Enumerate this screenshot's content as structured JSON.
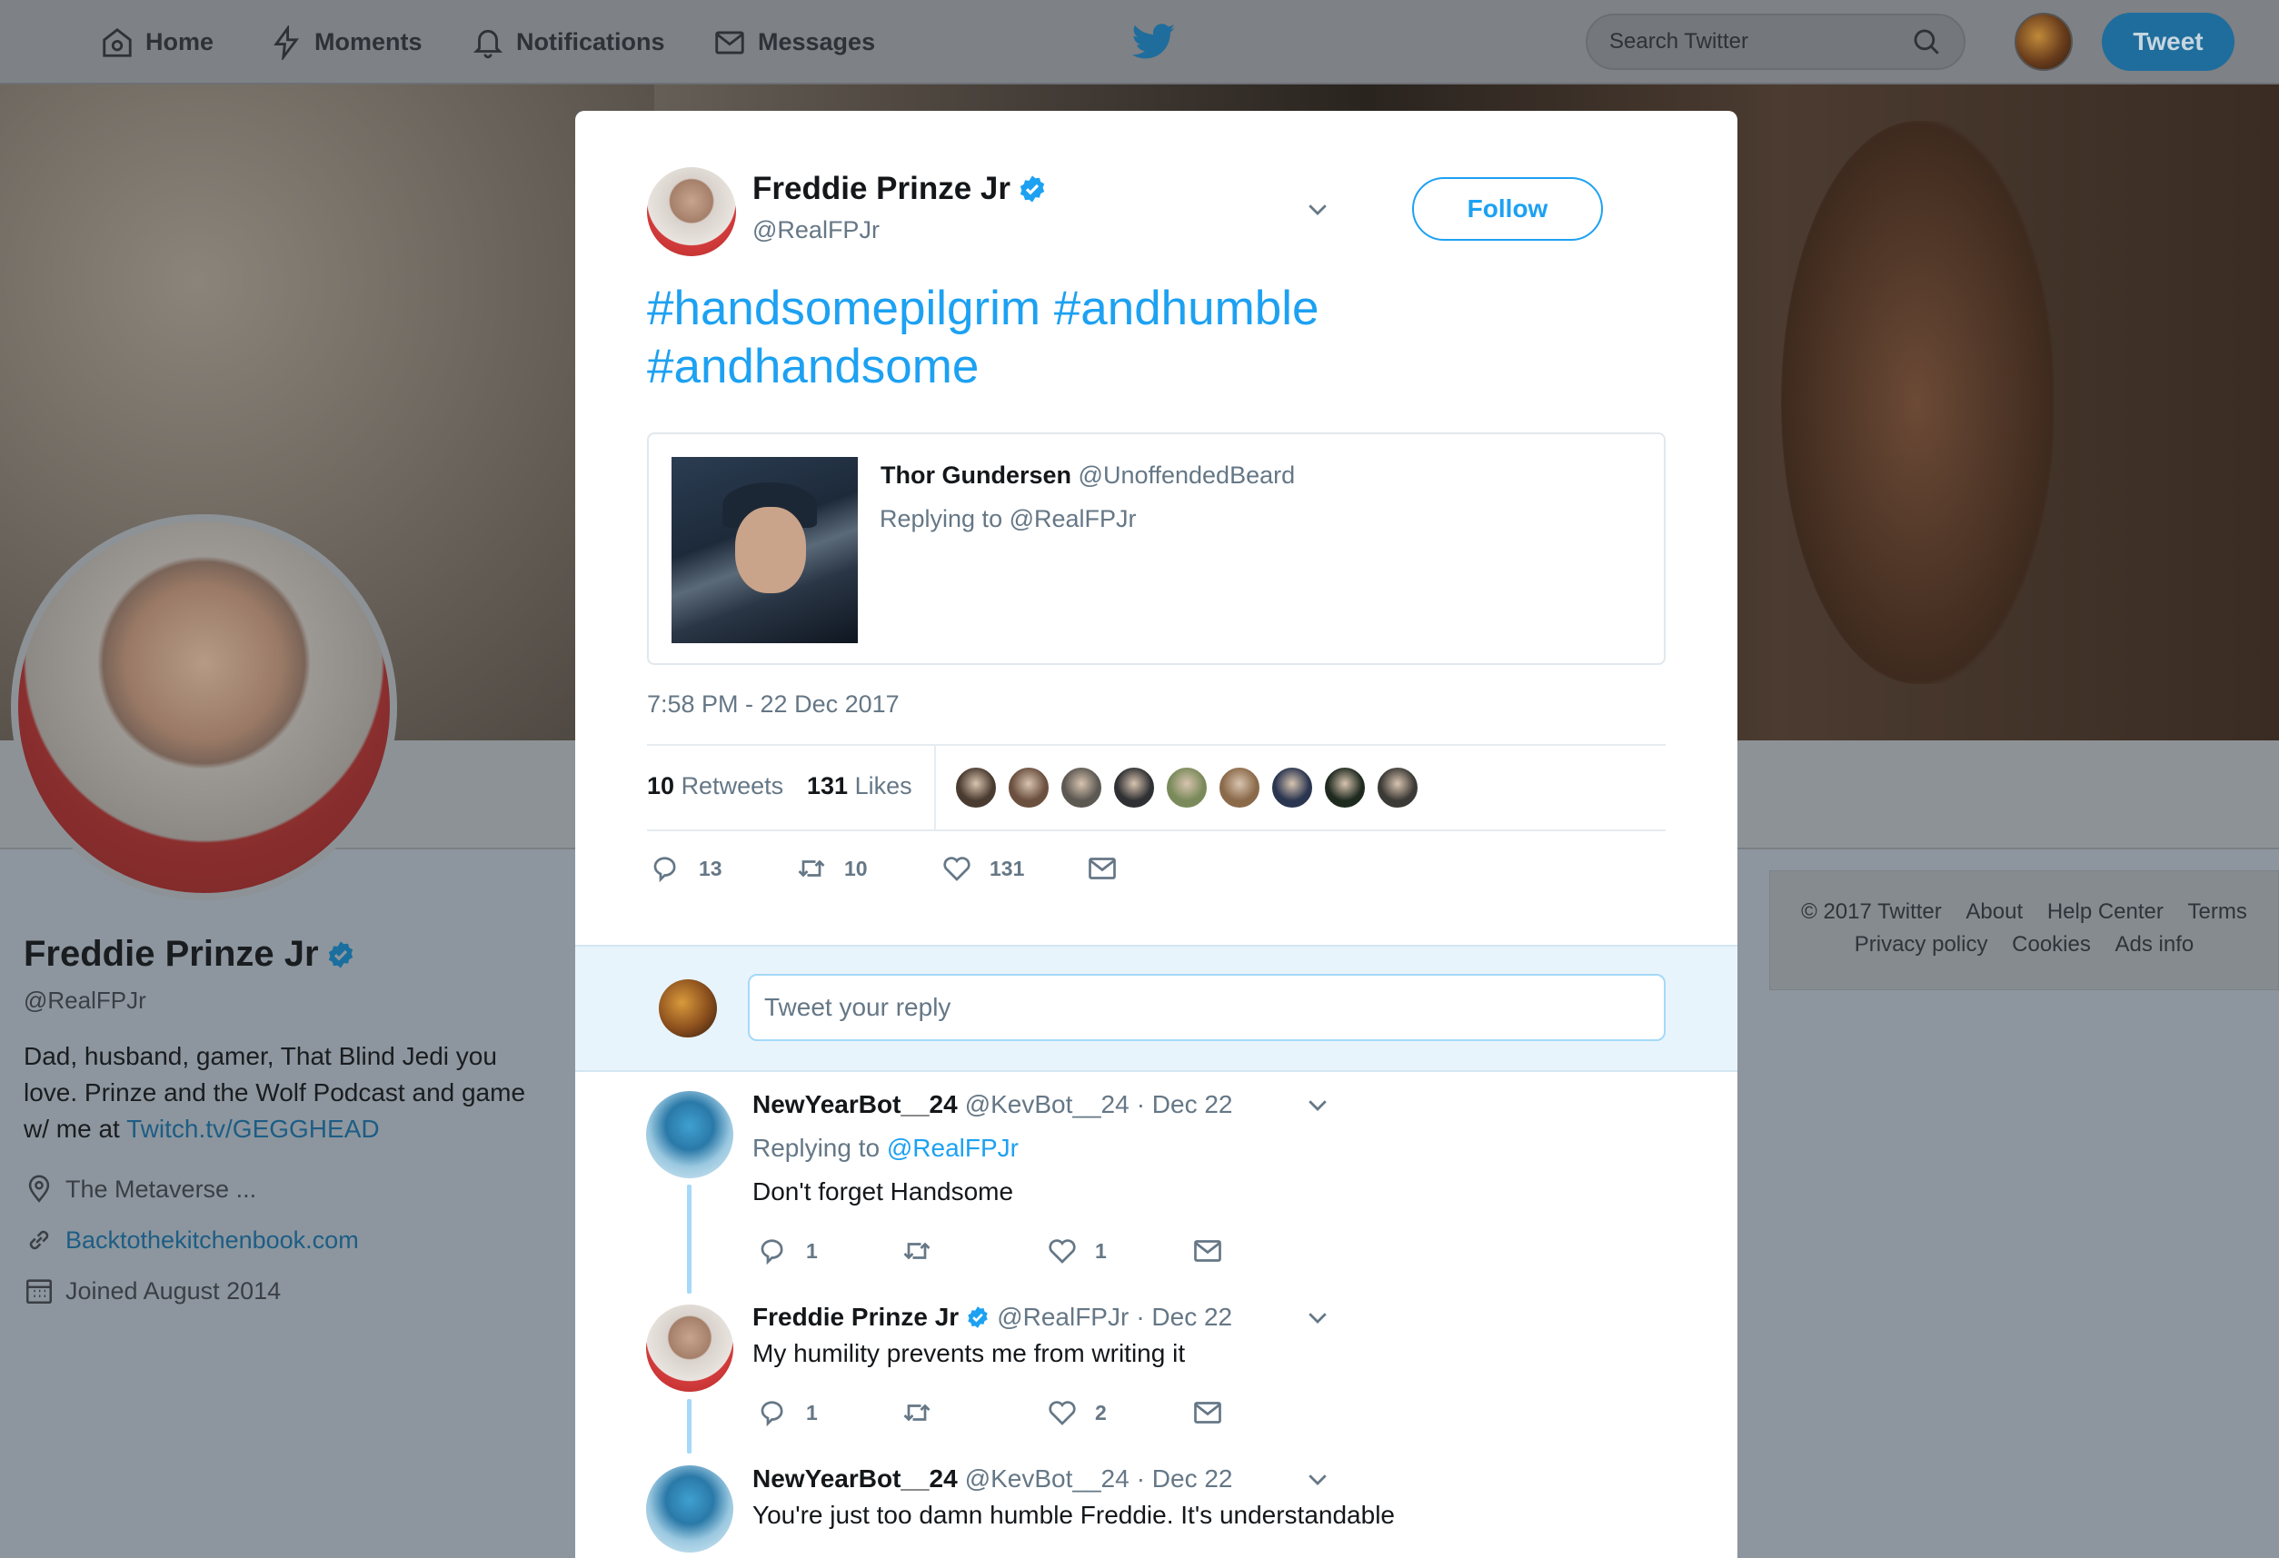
{
  "nav": {
    "items": [
      {
        "label": "Home",
        "icon": "home-icon"
      },
      {
        "label": "Moments",
        "icon": "lightning-icon"
      },
      {
        "label": "Notifications",
        "icon": "bell-icon"
      },
      {
        "label": "Messages",
        "icon": "envelope-icon"
      }
    ],
    "logo": "twitter-bird-icon",
    "search_placeholder": "Search Twitter",
    "tweet_button": "Tweet"
  },
  "profile": {
    "name": "Freddie Prinze Jr",
    "handle": "@RealFPJr",
    "bio_text": "Dad, husband, gamer, That Blind Jedi you love. Prinze and the Wolf Podcast and game w/ me at ",
    "bio_link": "Twitch.tv/GEGGHEAD",
    "location": "The Metaverse ...",
    "website": "Backtothekitchenbook.com",
    "joined": "Joined August 2014"
  },
  "footer": {
    "links": [
      "© 2017 Twitter",
      "About",
      "Help Center",
      "Terms",
      "Privacy policy",
      "Cookies",
      "Ads info"
    ]
  },
  "tweet": {
    "author_name": "Freddie Prinze Jr",
    "author_handle": "@RealFPJr",
    "follow_label": "Follow",
    "text_line1": "#handsomepilgrim #andhumble",
    "text_line2": "#andhandsome",
    "quoted": {
      "name": "Thor Gundersen",
      "handle": "@UnoffendedBeard",
      "replying": "Replying to @RealFPJr"
    },
    "timestamp": "7:58 PM - 22 Dec 2017",
    "retweets_count": "10",
    "retweets_label": "Retweets",
    "likes_count": "131",
    "likes_label": "Likes",
    "liker_colors": [
      "#4a3b30",
      "#6b4f3f",
      "#5c5852",
      "#2f3033",
      "#7a8a5a",
      "#8b6a4a",
      "#2a3550",
      "#1f2a1f",
      "#3c3a36"
    ],
    "actions": {
      "replies": "13",
      "retweets": "10",
      "likes": "131"
    }
  },
  "reply_box": {
    "placeholder": "Tweet your reply"
  },
  "replies": [
    {
      "name": "NewYearBot__24",
      "handle": "@KevBot__24",
      "date": "· Dec 22",
      "replying_prefix": "Replying to",
      "replying_to": "@RealFPJr",
      "text": "Don't forget Handsome",
      "replies": "1",
      "retweets": "",
      "likes": "1"
    },
    {
      "name": "Freddie Prinze Jr",
      "handle": "@RealFPJr",
      "date": "· Dec 22",
      "text": "My humility prevents me from writing it",
      "replies": "1",
      "retweets": "",
      "likes": "2"
    },
    {
      "name": "NewYearBot__24",
      "handle": "@KevBot__24",
      "date": "· Dec 22",
      "text": "You're just too damn humble Freddie. It's understandable"
    }
  ],
  "colors": {
    "accent": "#1da1f2",
    "text_secondary": "#657786",
    "thread_line": "#a4d9f9"
  }
}
